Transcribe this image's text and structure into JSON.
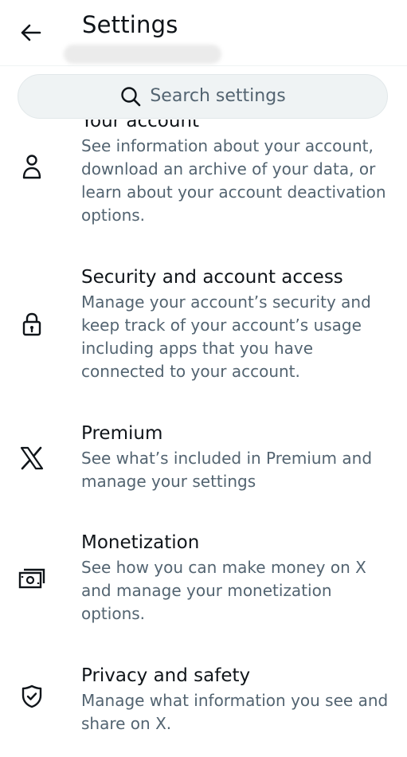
{
  "header": {
    "title": "Settings",
    "back_icon": "arrow-left-icon"
  },
  "search": {
    "placeholder": "Search settings",
    "icon": "search-icon"
  },
  "items": [
    {
      "title": "Your account",
      "description": "See information about your account, download an archive of your data, or learn about your account deactivation options.",
      "icon": "person-icon"
    },
    {
      "title": "Security and account access",
      "description": "Manage your account’s security and keep track of your account’s usage including apps that you have connected to your account.",
      "icon": "lock-icon"
    },
    {
      "title": "Premium",
      "description": "See what’s included in Premium and manage your settings",
      "icon": "x-logo-icon"
    },
    {
      "title": "Monetization",
      "description": "See how you can make money on X and manage your monetization options.",
      "icon": "money-icon"
    },
    {
      "title": "Privacy and safety",
      "description": "Manage what information you see and share on X.",
      "icon": "shield-check-icon"
    }
  ],
  "colors": {
    "primary_text": "#0f1419",
    "secondary_text": "#536471",
    "search_bg": "#eff3f4"
  }
}
